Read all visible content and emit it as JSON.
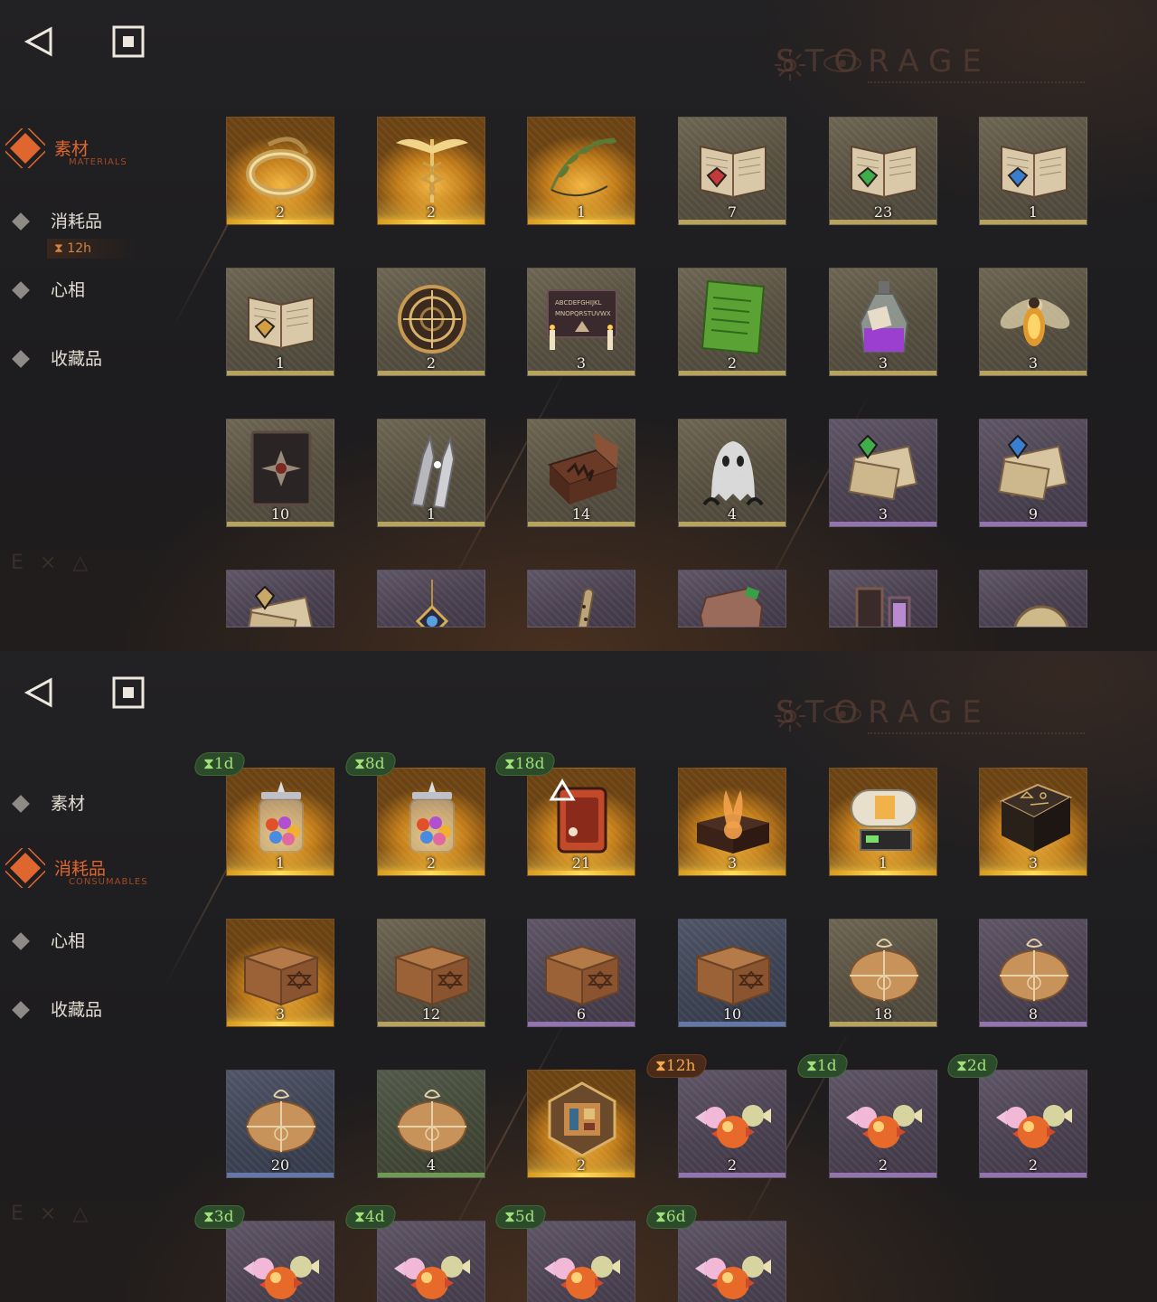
{
  "storage_title": "STORAGE",
  "nav": {
    "materials": "素材",
    "materials_sub": "MATERIALS",
    "consumables": "消耗品",
    "consumables_sub": "CONSUMABLES",
    "persona": "心相",
    "collectibles": "收藏品",
    "timer": "12h"
  },
  "accent_color": "#e0662f",
  "materials_grid": [
    {
      "item": "ring-icon",
      "qty": "2",
      "rarity": "gold"
    },
    {
      "item": "caduceus-icon",
      "qty": "2",
      "rarity": "gold"
    },
    {
      "item": "laurel-icon",
      "qty": "1",
      "rarity": "gold"
    },
    {
      "item": "red-book-icon",
      "qty": "7",
      "rarity": "khaki"
    },
    {
      "item": "green-book-icon",
      "qty": "23",
      "rarity": "khaki"
    },
    {
      "item": "blue-book-icon",
      "qty": "1",
      "rarity": "khaki"
    },
    {
      "item": "gold-book-icon",
      "qty": "1",
      "rarity": "khaki"
    },
    {
      "item": "astrolabe-icon",
      "qty": "2",
      "rarity": "khaki"
    },
    {
      "item": "ouija-board-icon",
      "qty": "3",
      "rarity": "khaki"
    },
    {
      "item": "green-tablet-icon",
      "qty": "2",
      "rarity": "khaki"
    },
    {
      "item": "potion-bottle-icon",
      "qty": "3",
      "rarity": "khaki"
    },
    {
      "item": "firefly-icon",
      "qty": "3",
      "rarity": "khaki"
    },
    {
      "item": "dark-tome-icon",
      "qty": "10",
      "rarity": "khaki"
    },
    {
      "item": "bullets-icon",
      "qty": "1",
      "rarity": "khaki"
    },
    {
      "item": "hand-box-icon",
      "qty": "14",
      "rarity": "khaki"
    },
    {
      "item": "ghost-icon",
      "qty": "4",
      "rarity": "khaki"
    },
    {
      "item": "green-scroll-icon",
      "qty": "3",
      "rarity": "purple"
    },
    {
      "item": "blue-scroll-icon",
      "qty": "9",
      "rarity": "purple"
    },
    {
      "item": "scroll-icon",
      "qty": "",
      "rarity": "purple"
    },
    {
      "item": "amulet-icon",
      "qty": "",
      "rarity": "purple"
    },
    {
      "item": "flute-icon",
      "qty": "",
      "rarity": "purple"
    },
    {
      "item": "stone-icon",
      "qty": "",
      "rarity": "purple"
    },
    {
      "item": "frame-icon",
      "qty": "",
      "rarity": "purple"
    },
    {
      "item": "compass-icon",
      "qty": "",
      "rarity": "purple"
    }
  ],
  "consumables_grid": [
    {
      "item": "candy-jar-icon",
      "qty": "1",
      "rarity": "gold",
      "timer": "1d",
      "timer_color": "green"
    },
    {
      "item": "candy-jar-icon",
      "qty": "2",
      "rarity": "gold",
      "timer": "8d",
      "timer_color": "green"
    },
    {
      "item": "red-device-icon",
      "qty": "21",
      "rarity": "gold",
      "timer": "18d",
      "timer_color": "green"
    },
    {
      "item": "rabbit-box-icon",
      "qty": "3",
      "rarity": "gold",
      "timer": "",
      "timer_color": ""
    },
    {
      "item": "capsule-machine-icon",
      "qty": "1",
      "rarity": "gold",
      "timer": "",
      "timer_color": ""
    },
    {
      "item": "rune-table-icon",
      "qty": "3",
      "rarity": "gold",
      "timer": "",
      "timer_color": ""
    },
    {
      "item": "wooden-crate-icon",
      "qty": "3",
      "rarity": "gold",
      "timer": "",
      "timer_color": ""
    },
    {
      "item": "wooden-crate-icon",
      "qty": "12",
      "rarity": "khaki",
      "timer": "",
      "timer_color": ""
    },
    {
      "item": "wooden-crate-icon",
      "qty": "6",
      "rarity": "purple",
      "timer": "",
      "timer_color": ""
    },
    {
      "item": "wooden-crate-icon",
      "qty": "10",
      "rarity": "blue",
      "timer": "",
      "timer_color": ""
    },
    {
      "item": "parcel-icon",
      "qty": "18",
      "rarity": "khaki",
      "timer": "",
      "timer_color": ""
    },
    {
      "item": "parcel-icon",
      "qty": "8",
      "rarity": "purple",
      "timer": "",
      "timer_color": ""
    },
    {
      "item": "parcel-icon",
      "qty": "20",
      "rarity": "blue",
      "timer": "",
      "timer_color": ""
    },
    {
      "item": "parcel-icon",
      "qty": "4",
      "rarity": "green",
      "timer": "",
      "timer_color": ""
    },
    {
      "item": "puzzle-box-icon",
      "qty": "2",
      "rarity": "gold",
      "timer": "",
      "timer_color": ""
    },
    {
      "item": "candies-icon",
      "qty": "2",
      "rarity": "purple",
      "timer": "12h",
      "timer_color": "orange"
    },
    {
      "item": "candies-icon",
      "qty": "2",
      "rarity": "purple",
      "timer": "1d",
      "timer_color": "green"
    },
    {
      "item": "candies-icon",
      "qty": "2",
      "rarity": "purple",
      "timer": "2d",
      "timer_color": "green"
    },
    {
      "item": "candies-icon",
      "qty": "",
      "rarity": "purple",
      "timer": "3d",
      "timer_color": "green"
    },
    {
      "item": "candies-icon",
      "qty": "",
      "rarity": "purple",
      "timer": "4d",
      "timer_color": "green"
    },
    {
      "item": "candies-icon",
      "qty": "",
      "rarity": "purple",
      "timer": "5d",
      "timer_color": "green"
    },
    {
      "item": "candies-icon",
      "qty": "",
      "rarity": "purple",
      "timer": "6d",
      "timer_color": "green"
    }
  ]
}
